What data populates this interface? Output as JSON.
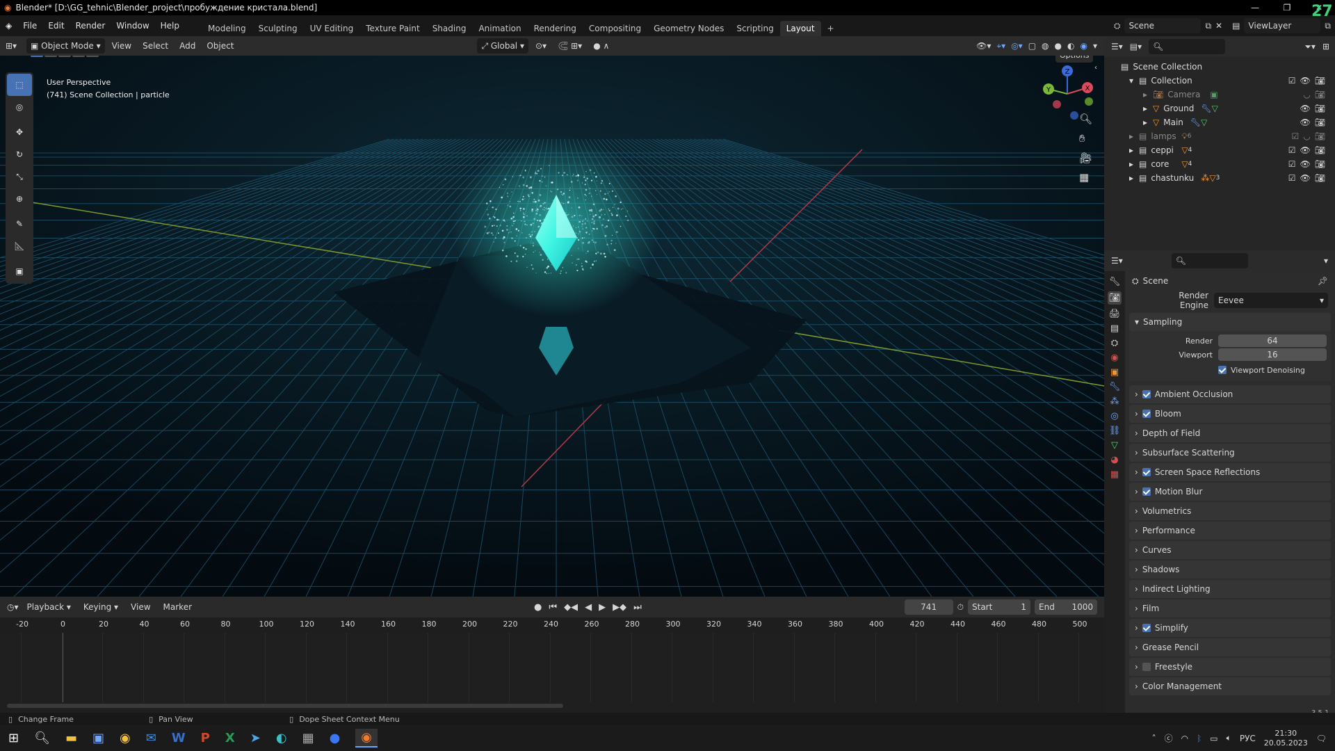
{
  "title": "Blender* [D:\\GG_tehnic\\Blender_project\\пробуждение кристала.blend]",
  "corner_number": "27",
  "menu": [
    "File",
    "Edit",
    "Render",
    "Window",
    "Help"
  ],
  "workspaces": [
    "Modeling",
    "Sculpting",
    "UV Editing",
    "Texture Paint",
    "Shading",
    "Animation",
    "Rendering",
    "Compositing",
    "Geometry Nodes",
    "Scripting",
    "Layout"
  ],
  "active_workspace": "Layout",
  "scene": "Scene",
  "view_layer": "ViewLayer",
  "viewport_header": {
    "mode": "Object Mode",
    "menus": [
      "View",
      "Select",
      "Add",
      "Object"
    ],
    "transform": "Global"
  },
  "options": "Options",
  "overlay_text": {
    "line1": "User Perspective",
    "line2": "(741) Scene Collection | particle"
  },
  "gizmo": {
    "x": "X",
    "y": "Y",
    "z": "Z"
  },
  "outliner": {
    "root": "Scene Collection",
    "collection": "Collection",
    "items": [
      {
        "label": "Camera",
        "dim": true
      },
      {
        "label": "Ground",
        "dim": false
      },
      {
        "label": "Main",
        "dim": false
      }
    ],
    "collections": [
      {
        "label": "lamps",
        "count": "6",
        "dim": true
      },
      {
        "label": "ceppi",
        "count": "4",
        "dim": false
      },
      {
        "label": "core",
        "count": "4",
        "dim": false
      },
      {
        "label": "chastunku",
        "count": "3",
        "dim": false
      }
    ]
  },
  "properties": {
    "context": "Scene",
    "render_engine_label": "Render Engine",
    "render_engine": "Eevee",
    "sampling": "Sampling",
    "render_label": "Render",
    "render_value": "64",
    "viewport_label": "Viewport",
    "viewport_value": "16",
    "viewport_denoising": "Viewport Denoising",
    "panels": [
      {
        "label": "Ambient Occlusion",
        "checkbox": true
      },
      {
        "label": "Bloom",
        "checkbox": true
      },
      {
        "label": "Depth of Field",
        "checkbox": null
      },
      {
        "label": "Subsurface Scattering",
        "checkbox": null
      },
      {
        "label": "Screen Space Reflections",
        "checkbox": true
      },
      {
        "label": "Motion Blur",
        "checkbox": true
      },
      {
        "label": "Volumetrics",
        "checkbox": null
      },
      {
        "label": "Performance",
        "checkbox": null
      },
      {
        "label": "Curves",
        "checkbox": null
      },
      {
        "label": "Shadows",
        "checkbox": null
      },
      {
        "label": "Indirect Lighting",
        "checkbox": null
      },
      {
        "label": "Film",
        "checkbox": null
      },
      {
        "label": "Simplify",
        "checkbox": true
      },
      {
        "label": "Grease Pencil",
        "checkbox": null
      },
      {
        "label": "Freestyle",
        "checkbox": false
      },
      {
        "label": "Color Management",
        "checkbox": null
      }
    ]
  },
  "timeline": {
    "menus": [
      "Playback",
      "Keying",
      "View",
      "Marker"
    ],
    "current_frame": "741",
    "start_label": "Start",
    "start": "1",
    "end_label": "End",
    "end": "1000",
    "ticks": [
      "-20",
      "0",
      "20",
      "40",
      "60",
      "80",
      "100",
      "120",
      "140",
      "160",
      "180",
      "200",
      "220",
      "240",
      "260",
      "280",
      "300",
      "320",
      "340",
      "360",
      "380",
      "400",
      "420",
      "440",
      "460",
      "480",
      "500"
    ]
  },
  "status": {
    "left": "Change Frame",
    "mid": "Pan View",
    "right": "Dope Sheet Context Menu",
    "version": "3.5.1"
  },
  "taskbar": {
    "lang": "РУС",
    "time": "21:30",
    "date": "20.05.2023"
  },
  "colors": {
    "accent": "#4772b3",
    "crystal": "#3fffe8",
    "grid": "#1a5a78",
    "active_tab": "#303030"
  }
}
